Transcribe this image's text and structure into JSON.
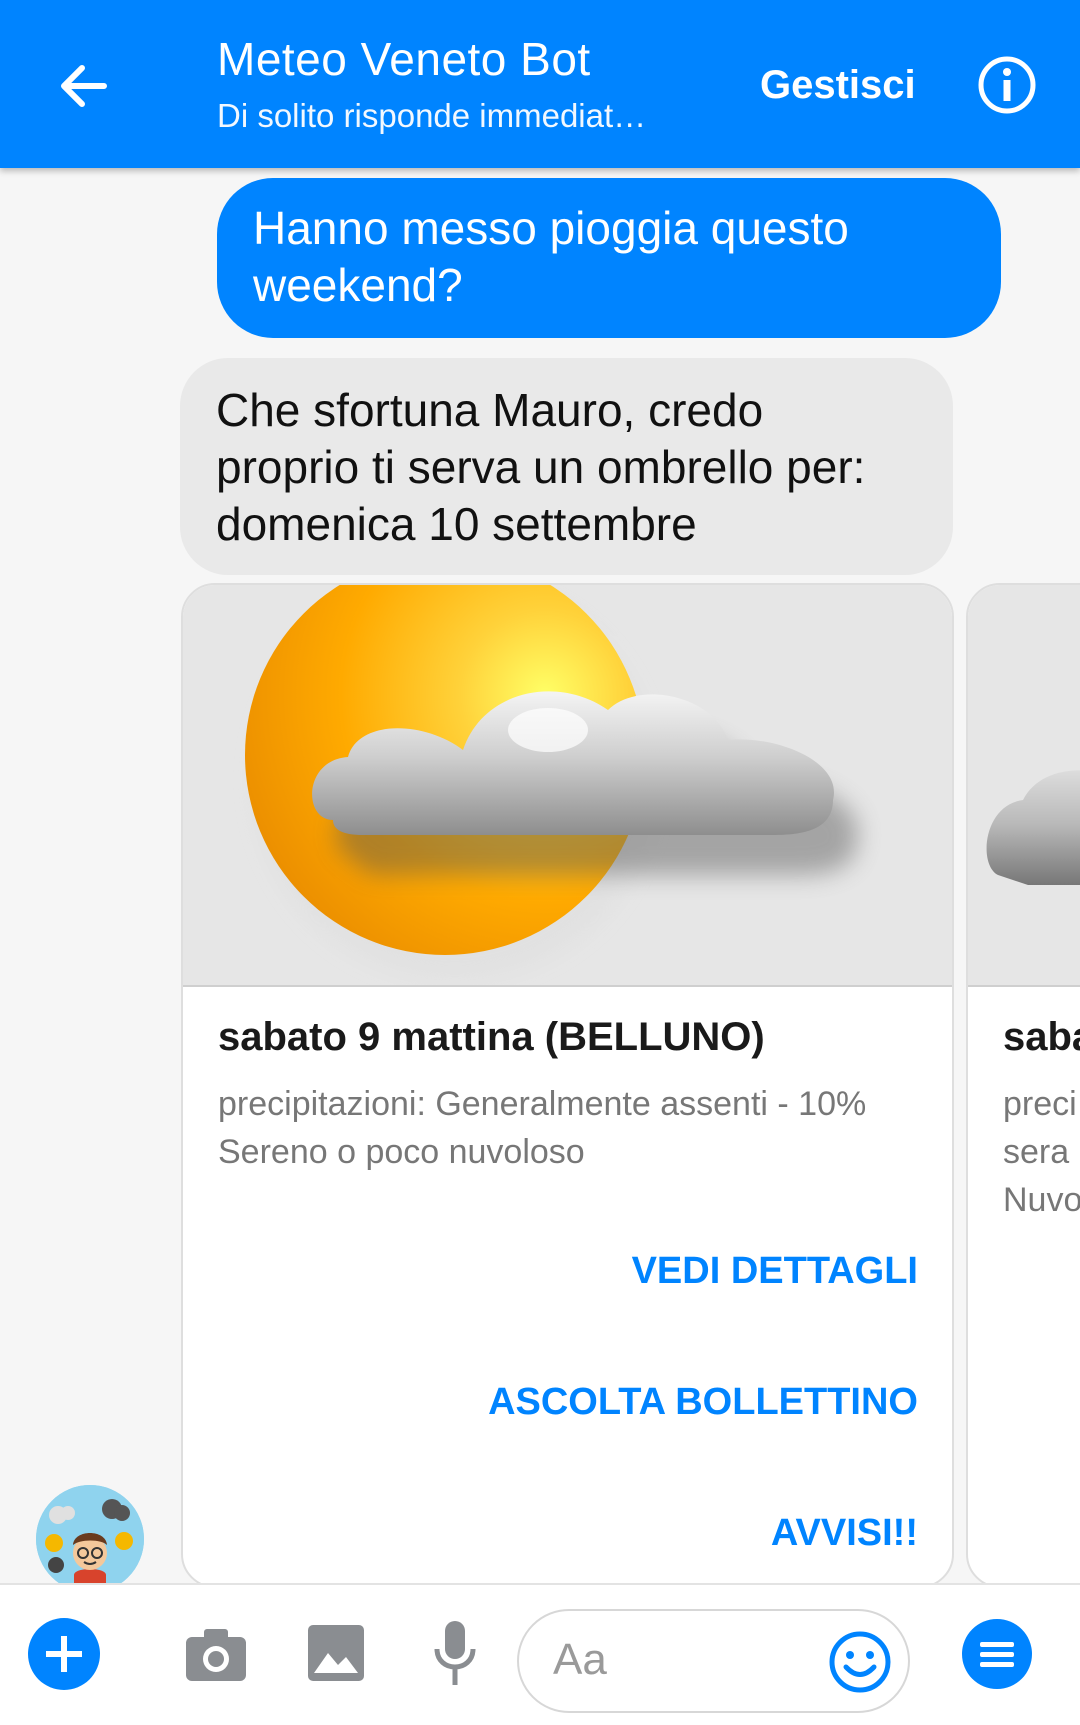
{
  "header": {
    "title": "Meteo Veneto Bot",
    "subtitle": "Di solito risponde immediat…",
    "manage_label": "Gestisci",
    "accent_color": "#0084ff",
    "back_icon": "arrow-left-icon",
    "info_icon": "info-icon"
  },
  "messages": {
    "outgoing": {
      "line1": "Hanno messo pioggia questo",
      "line2": "weekend?"
    },
    "incoming": {
      "line1": "Che sfortuna Mauro, credo",
      "line2": "proprio ti serva un ombrello per:",
      "line3": "domenica 10 settembre"
    }
  },
  "cards": [
    {
      "image_icon": "sun-cloud-weather-icon",
      "title": "sabato 9 mattina (BELLUNO)",
      "line1": "precipitazioni: Generalmente assenti - 10%",
      "line2": "Sereno o poco nuvoloso",
      "buttons": [
        "VEDI DETTAGLI",
        "ASCOLTA BOLLETTINO",
        "AVVISI!!"
      ]
    },
    {
      "image_icon": "cloud-weather-icon",
      "title": "saba",
      "line1": "preci",
      "line2": "sera",
      "line3": "Nuvo"
    }
  ],
  "composer": {
    "placeholder": "Aa",
    "icons": [
      "plus-icon",
      "camera-icon",
      "image-icon",
      "microphone-icon",
      "emoji-icon",
      "menu-icon"
    ]
  }
}
